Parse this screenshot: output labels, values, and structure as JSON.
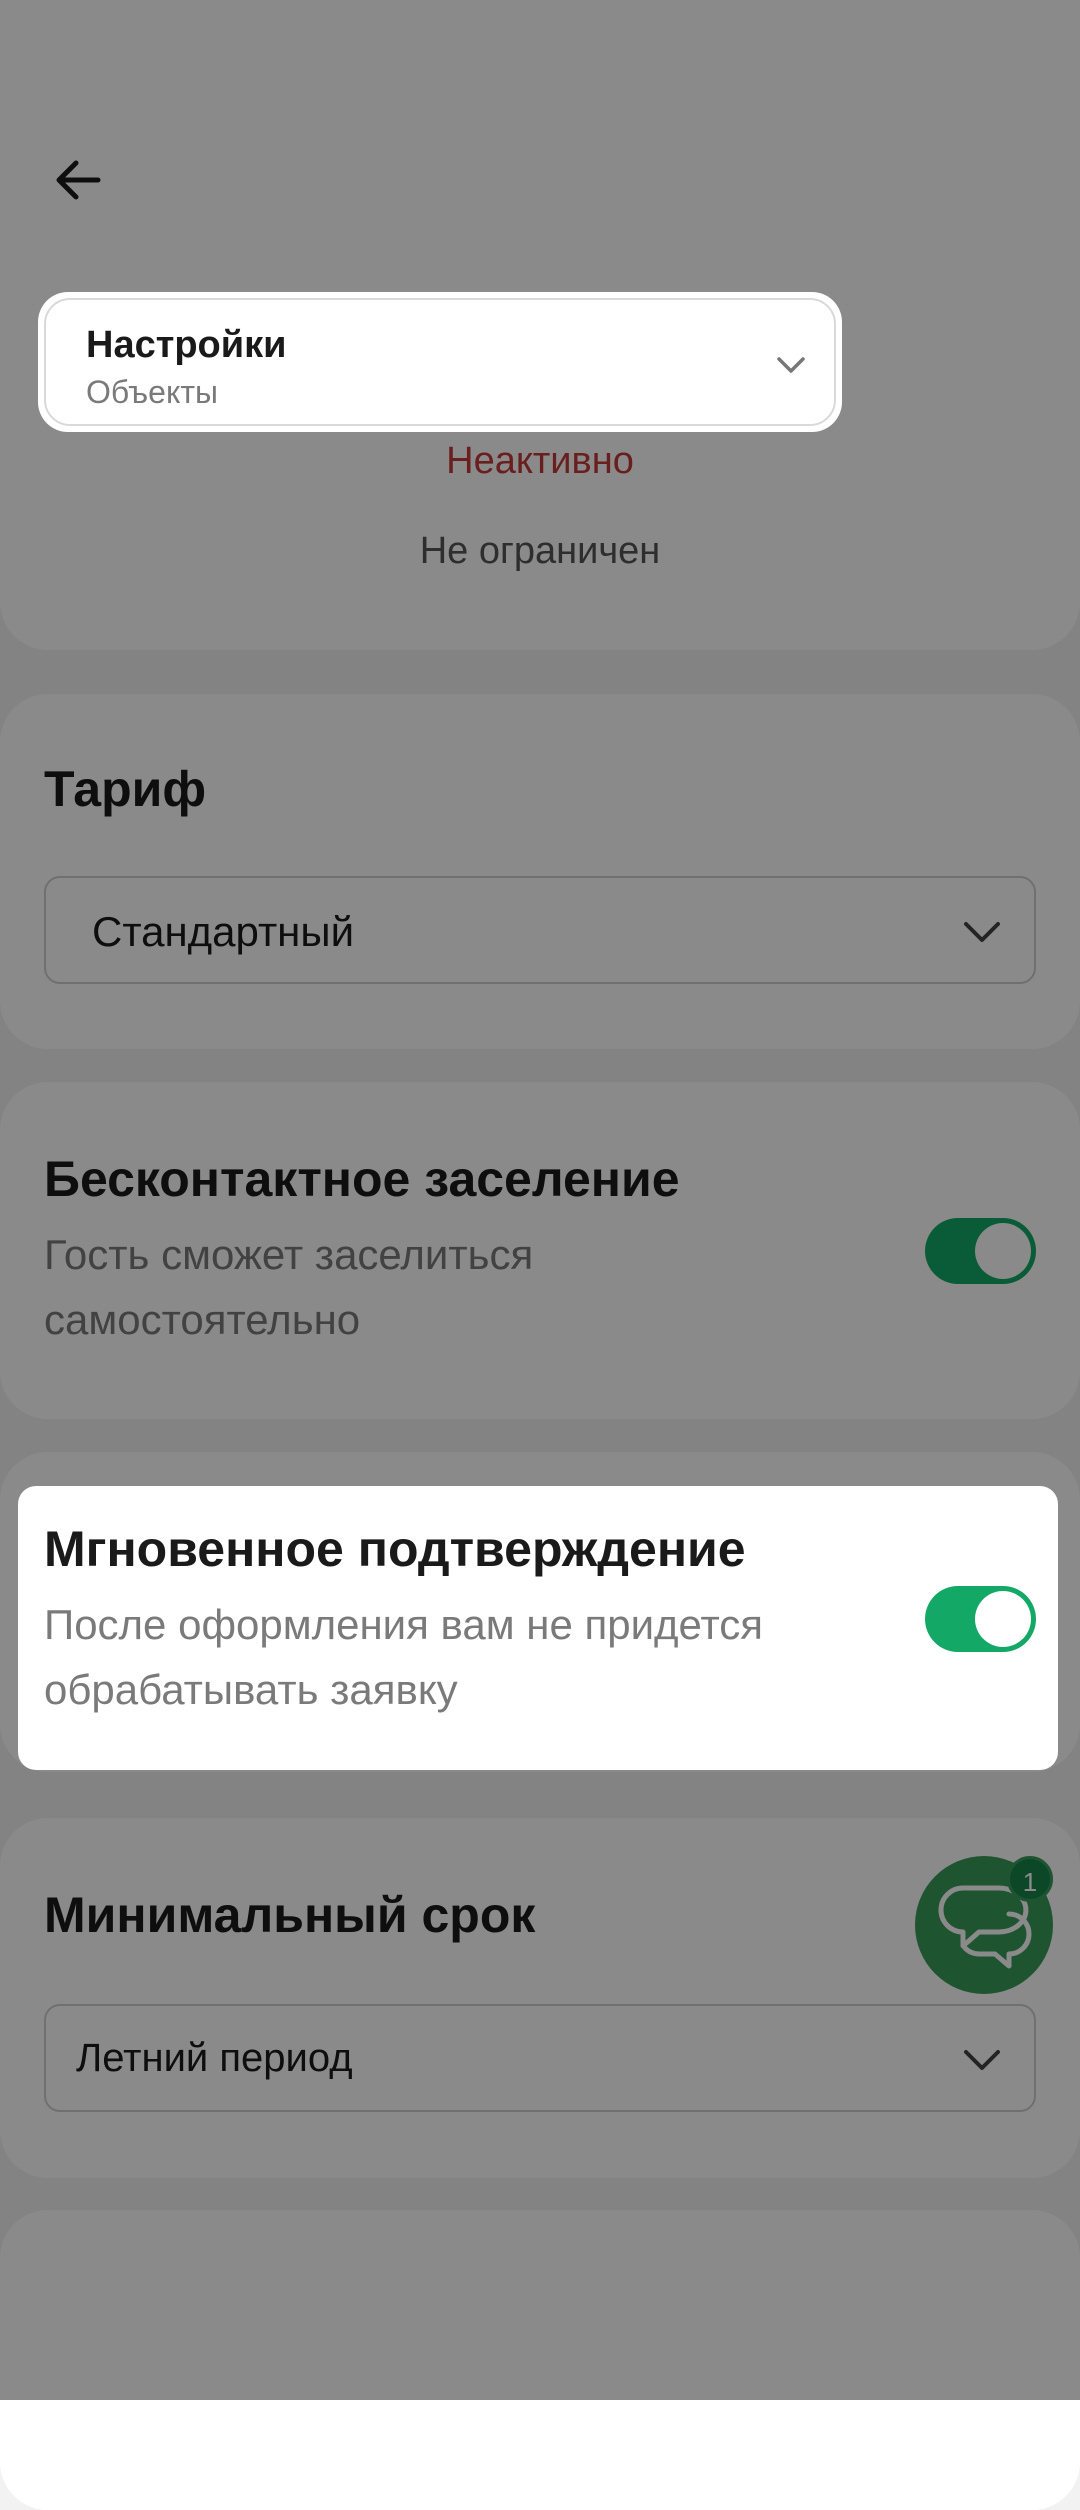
{
  "header": {
    "section_selector": {
      "title": "Настройки",
      "subtitle": "Объекты"
    }
  },
  "status": {
    "inactive_label": "Неактивно",
    "limit_label": "Не ограничен"
  },
  "tariff": {
    "title": "Тариф",
    "selected": "Стандартный"
  },
  "contactless": {
    "title": "Бесконтактное заселение",
    "description_line1": "Гость сможет заселиться",
    "description_line2": "самостоятельно",
    "enabled": true
  },
  "instant_confirmation": {
    "title": "Мгновенное подтверждение",
    "description_line1": "После оформления вам не придется",
    "description_line2": "обрабатывать заявку",
    "enabled": true
  },
  "min_stay": {
    "title": "Минимальный срок",
    "selected": "Летний период"
  },
  "chat": {
    "badge_count": "1"
  },
  "colors": {
    "accent_green": "#14a866",
    "inactive_red": "#c43a3a",
    "chat_green": "#3a9c5c"
  },
  "icons": {
    "back": "arrow-left-icon",
    "chevron": "chevron-down-icon",
    "chat": "chat-bubbles-icon"
  }
}
